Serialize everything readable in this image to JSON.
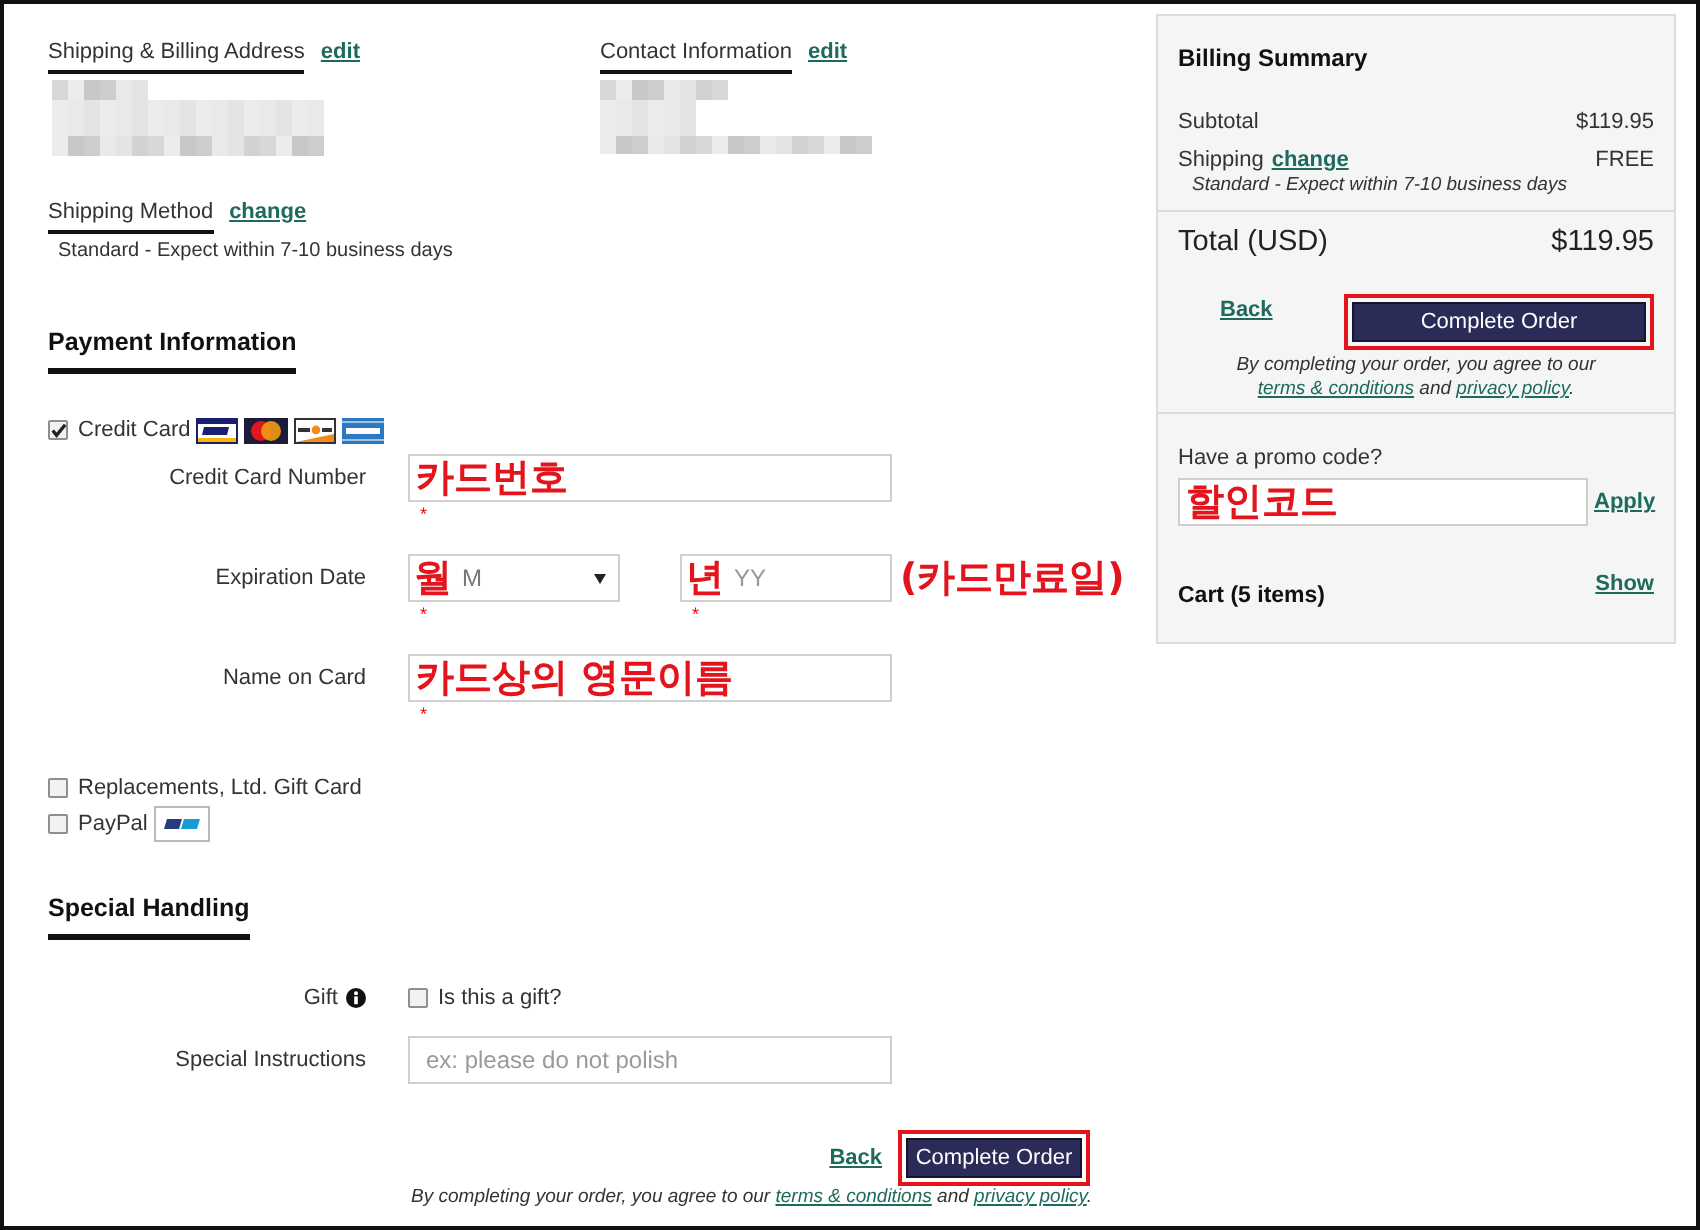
{
  "addresses": [
    {
      "title": "Shipping & Billing Address",
      "link": "edit",
      "blurred": true
    },
    {
      "title": "Contact Information",
      "link": "edit",
      "blurred": true
    }
  ],
  "shipping_method": {
    "title": "Shipping Method",
    "link": "change",
    "value": "Standard - Expect within 7-10 business days"
  },
  "payment": {
    "title": "Payment Information",
    "options": [
      {
        "kind": "credit_card",
        "label": "Credit Card",
        "checked": true,
        "fields": [
          {
            "kind": "text",
            "label": "Credit Card Number",
            "annotation": "카드번호",
            "required_mark": "*"
          },
          {
            "kind": "expiry",
            "label": "Expiration Date",
            "month": {
              "placeholder": "M",
              "annotation": "월",
              "required_mark": "*"
            },
            "year": {
              "placeholder": "YY",
              "annotation": "년",
              "required_mark": "*"
            },
            "note": "(카드만료일)"
          },
          {
            "kind": "text",
            "label": "Name on Card",
            "annotation": "카드상의 영문이름",
            "required_mark": "*"
          }
        ]
      },
      {
        "kind": "gift_card",
        "label": "Replacements, Ltd. Gift Card",
        "checked": false
      },
      {
        "kind": "paypal",
        "label": "PayPal",
        "checked": false
      }
    ]
  },
  "special_handling": {
    "title": "Special Handling",
    "gift": {
      "label": "Gift",
      "checkbox_label": "Is this a gift?",
      "checked": false
    },
    "instructions": {
      "label": "Special Instructions",
      "placeholder": "ex: please do not polish"
    }
  },
  "order_actions": {
    "back": "Back",
    "button": {
      "label": "Complete Order",
      "highlighted": true
    },
    "disclaimer": {
      "text_before": "By completing your order, you agree to our",
      "terms_link": "terms & conditions",
      "text_middle": "and",
      "privacy_link": "privacy policy",
      "text_after": "."
    }
  },
  "billing_summary": {
    "title": "Billing Summary",
    "lines": [
      {
        "label": "Subtotal",
        "value": "$119.95"
      },
      {
        "label": "Shipping",
        "link": "change",
        "value": "FREE",
        "note": "Standard - Expect within 7-10 business days"
      }
    ],
    "total": {
      "label": "Total (USD)",
      "value": "$119.95"
    },
    "back": "Back",
    "button": {
      "label": "Complete Order",
      "highlighted": true
    },
    "disclaimer": {
      "text_before": "By completing your order, you agree to our",
      "terms_link": "terms & conditions",
      "text_middle": "and",
      "privacy_link": "privacy policy",
      "text_after": "."
    },
    "promo": {
      "label": "Have a promo code?",
      "annotation": "할인코드",
      "action": "Apply"
    },
    "cart": {
      "label": "Cart (5 items)",
      "action": "Show"
    }
  }
}
